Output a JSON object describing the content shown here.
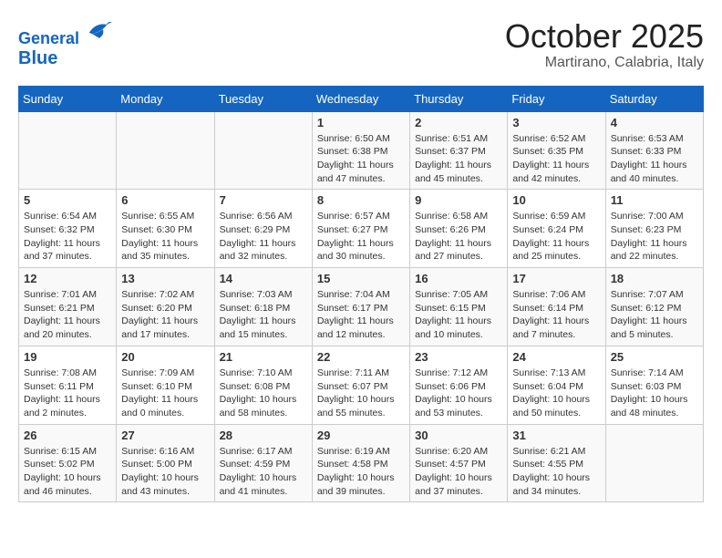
{
  "header": {
    "logo_line1": "General",
    "logo_line2": "Blue",
    "month": "October 2025",
    "location": "Martirano, Calabria, Italy"
  },
  "days_of_week": [
    "Sunday",
    "Monday",
    "Tuesday",
    "Wednesday",
    "Thursday",
    "Friday",
    "Saturday"
  ],
  "weeks": [
    [
      {
        "day": "",
        "info": ""
      },
      {
        "day": "",
        "info": ""
      },
      {
        "day": "",
        "info": ""
      },
      {
        "day": "1",
        "info": "Sunrise: 6:50 AM\nSunset: 6:38 PM\nDaylight: 11 hours\nand 47 minutes."
      },
      {
        "day": "2",
        "info": "Sunrise: 6:51 AM\nSunset: 6:37 PM\nDaylight: 11 hours\nand 45 minutes."
      },
      {
        "day": "3",
        "info": "Sunrise: 6:52 AM\nSunset: 6:35 PM\nDaylight: 11 hours\nand 42 minutes."
      },
      {
        "day": "4",
        "info": "Sunrise: 6:53 AM\nSunset: 6:33 PM\nDaylight: 11 hours\nand 40 minutes."
      }
    ],
    [
      {
        "day": "5",
        "info": "Sunrise: 6:54 AM\nSunset: 6:32 PM\nDaylight: 11 hours\nand 37 minutes."
      },
      {
        "day": "6",
        "info": "Sunrise: 6:55 AM\nSunset: 6:30 PM\nDaylight: 11 hours\nand 35 minutes."
      },
      {
        "day": "7",
        "info": "Sunrise: 6:56 AM\nSunset: 6:29 PM\nDaylight: 11 hours\nand 32 minutes."
      },
      {
        "day": "8",
        "info": "Sunrise: 6:57 AM\nSunset: 6:27 PM\nDaylight: 11 hours\nand 30 minutes."
      },
      {
        "day": "9",
        "info": "Sunrise: 6:58 AM\nSunset: 6:26 PM\nDaylight: 11 hours\nand 27 minutes."
      },
      {
        "day": "10",
        "info": "Sunrise: 6:59 AM\nSunset: 6:24 PM\nDaylight: 11 hours\nand 25 minutes."
      },
      {
        "day": "11",
        "info": "Sunrise: 7:00 AM\nSunset: 6:23 PM\nDaylight: 11 hours\nand 22 minutes."
      }
    ],
    [
      {
        "day": "12",
        "info": "Sunrise: 7:01 AM\nSunset: 6:21 PM\nDaylight: 11 hours\nand 20 minutes."
      },
      {
        "day": "13",
        "info": "Sunrise: 7:02 AM\nSunset: 6:20 PM\nDaylight: 11 hours\nand 17 minutes."
      },
      {
        "day": "14",
        "info": "Sunrise: 7:03 AM\nSunset: 6:18 PM\nDaylight: 11 hours\nand 15 minutes."
      },
      {
        "day": "15",
        "info": "Sunrise: 7:04 AM\nSunset: 6:17 PM\nDaylight: 11 hours\nand 12 minutes."
      },
      {
        "day": "16",
        "info": "Sunrise: 7:05 AM\nSunset: 6:15 PM\nDaylight: 11 hours\nand 10 minutes."
      },
      {
        "day": "17",
        "info": "Sunrise: 7:06 AM\nSunset: 6:14 PM\nDaylight: 11 hours\nand 7 minutes."
      },
      {
        "day": "18",
        "info": "Sunrise: 7:07 AM\nSunset: 6:12 PM\nDaylight: 11 hours\nand 5 minutes."
      }
    ],
    [
      {
        "day": "19",
        "info": "Sunrise: 7:08 AM\nSunset: 6:11 PM\nDaylight: 11 hours\nand 2 minutes."
      },
      {
        "day": "20",
        "info": "Sunrise: 7:09 AM\nSunset: 6:10 PM\nDaylight: 11 hours\nand 0 minutes."
      },
      {
        "day": "21",
        "info": "Sunrise: 7:10 AM\nSunset: 6:08 PM\nDaylight: 10 hours\nand 58 minutes."
      },
      {
        "day": "22",
        "info": "Sunrise: 7:11 AM\nSunset: 6:07 PM\nDaylight: 10 hours\nand 55 minutes."
      },
      {
        "day": "23",
        "info": "Sunrise: 7:12 AM\nSunset: 6:06 PM\nDaylight: 10 hours\nand 53 minutes."
      },
      {
        "day": "24",
        "info": "Sunrise: 7:13 AM\nSunset: 6:04 PM\nDaylight: 10 hours\nand 50 minutes."
      },
      {
        "day": "25",
        "info": "Sunrise: 7:14 AM\nSunset: 6:03 PM\nDaylight: 10 hours\nand 48 minutes."
      }
    ],
    [
      {
        "day": "26",
        "info": "Sunrise: 6:15 AM\nSunset: 5:02 PM\nDaylight: 10 hours\nand 46 minutes."
      },
      {
        "day": "27",
        "info": "Sunrise: 6:16 AM\nSunset: 5:00 PM\nDaylight: 10 hours\nand 43 minutes."
      },
      {
        "day": "28",
        "info": "Sunrise: 6:17 AM\nSunset: 4:59 PM\nDaylight: 10 hours\nand 41 minutes."
      },
      {
        "day": "29",
        "info": "Sunrise: 6:19 AM\nSunset: 4:58 PM\nDaylight: 10 hours\nand 39 minutes."
      },
      {
        "day": "30",
        "info": "Sunrise: 6:20 AM\nSunset: 4:57 PM\nDaylight: 10 hours\nand 37 minutes."
      },
      {
        "day": "31",
        "info": "Sunrise: 6:21 AM\nSunset: 4:55 PM\nDaylight: 10 hours\nand 34 minutes."
      },
      {
        "day": "",
        "info": ""
      }
    ]
  ]
}
